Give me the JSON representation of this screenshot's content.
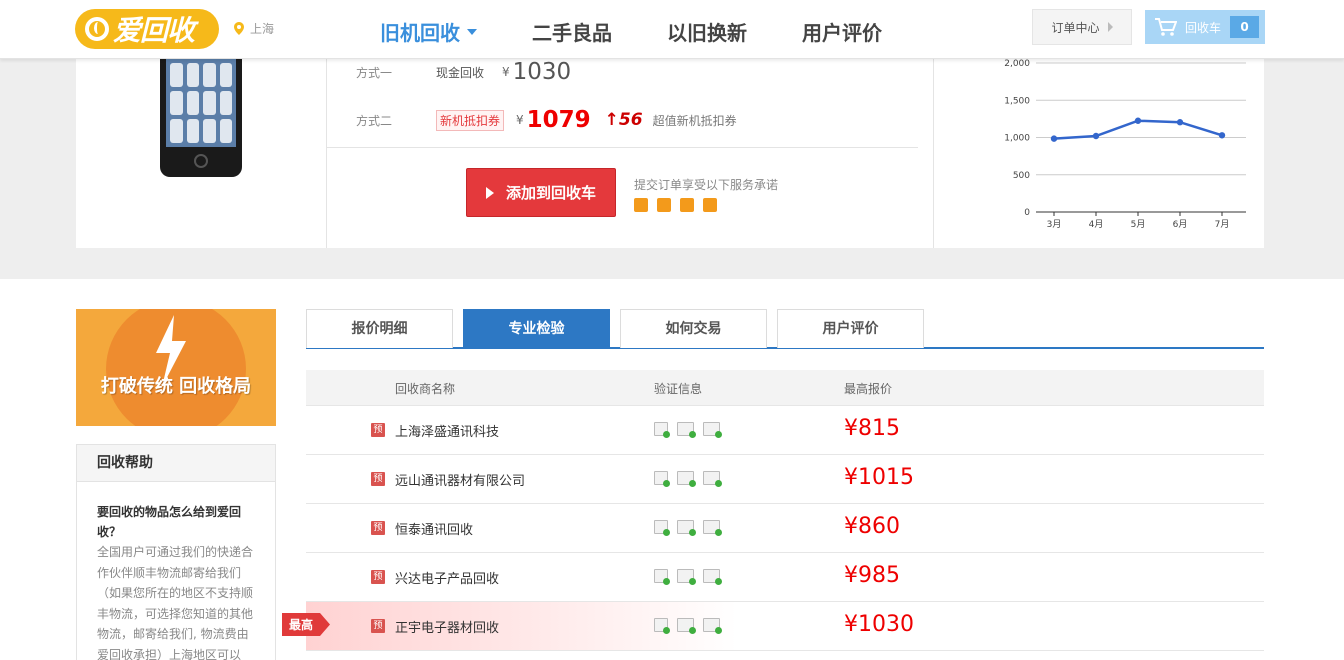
{
  "header": {
    "logo_text": "爱回收",
    "location": "上海",
    "nav": [
      "旧机回收",
      "二手良品",
      "以旧换新",
      "用户评价"
    ],
    "order_center": "订单中心",
    "cart_label": "回收车",
    "cart_count": "0"
  },
  "product": {
    "mode1": {
      "label": "方式一",
      "type": "现金回收",
      "currency": "¥",
      "price": "1030"
    },
    "mode2": {
      "label": "方式二",
      "type": "新机抵扣券",
      "currency": "¥",
      "price": "1079",
      "extra": "↑56",
      "extra_desc": "超值新机抵扣券"
    },
    "add_button": "添加到回收车",
    "promise_text": "提交订单享受以下服务承诺"
  },
  "chart_data": {
    "type": "line",
    "categories": [
      "3月",
      "4月",
      "5月",
      "6月",
      "7月"
    ],
    "values": [
      985,
      1020,
      1225,
      1205,
      1030
    ],
    "ylim": [
      0,
      2000
    ],
    "yticks": [
      "2,000",
      "1,500",
      "1,000",
      "500",
      "0"
    ],
    "grid": true,
    "colors": {
      "line": "#3366cc"
    }
  },
  "banner": {
    "text": "打破传统 回收格局"
  },
  "help": {
    "title": "回收帮助",
    "question": "要回收的物品怎么给到爱回收？",
    "answer": "全国用户可通过我们的快递合作伙伴顺丰物流邮寄给我们（如果您所在的地区不支持顺丰物流，可选择您知道的其他物流，邮寄给我们, 物流费由爱回收承担）上海地区可以"
  },
  "tabs": [
    "报价明细",
    "专业检验",
    "如何交易",
    "用户评价"
  ],
  "table": {
    "headers": [
      "回收商名称",
      "验证信息",
      "最高报价"
    ],
    "badge": "预",
    "best_label": "最高",
    "rows": [
      {
        "name": "上海泽盛通讯科技",
        "price": "¥815"
      },
      {
        "name": "远山通讯器材有限公司",
        "price": "¥1015"
      },
      {
        "name": "恒泰通讯回收",
        "price": "¥860"
      },
      {
        "name": "兴达电子产品回收",
        "price": "¥985"
      },
      {
        "name": "正宇电子器材回收",
        "price": "¥1030"
      }
    ]
  }
}
